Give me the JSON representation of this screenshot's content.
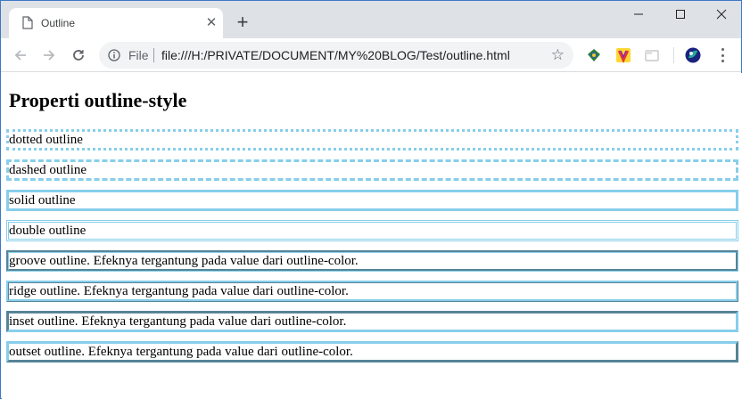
{
  "browser": {
    "tab": {
      "title": "Outline",
      "close_glyph": "✕"
    },
    "new_tab_glyph": "+",
    "window_controls": {
      "minimize": "—",
      "maximize": "☐",
      "close": "✕"
    },
    "address": {
      "scheme_label": "File",
      "url": "file:///H:/PRIVATE/DOCUMENT/MY%20BLOG/Test/outline.html"
    },
    "bookmark_glyph": "☆",
    "icons": [
      "page-icon",
      "back-arrow-icon",
      "forward-arrow-icon",
      "reload-icon",
      "info-icon",
      "star-icon",
      "extension-icon",
      "menu-icon"
    ]
  },
  "page": {
    "heading": "Properti outline-style",
    "items": [
      {
        "style": "dotted",
        "text": "dotted outline"
      },
      {
        "style": "dashed",
        "text": "dashed outline"
      },
      {
        "style": "solid",
        "text": "solid outline"
      },
      {
        "style": "double",
        "text": "double outline"
      },
      {
        "style": "groove",
        "text": "groove outline. Efeknya tergantung pada value dari outline-color."
      },
      {
        "style": "ridge",
        "text": "ridge outline. Efeknya tergantung pada value dari outline-color."
      },
      {
        "style": "inset",
        "text": "inset outline. Efeknya tergantung pada value dari outline-color."
      },
      {
        "style": "outset",
        "text": "outset outline. Efeknya tergantung pada value dari outline-color."
      }
    ],
    "outline_color": "#87ceeb"
  }
}
